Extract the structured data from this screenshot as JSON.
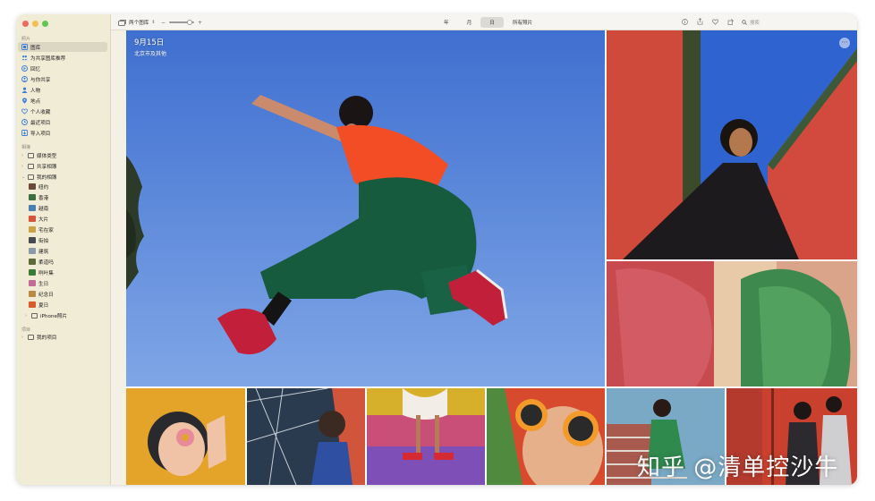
{
  "toolbar": {
    "library_selector": "两个图库",
    "view_tabs": [
      {
        "label": "年",
        "active": false
      },
      {
        "label": "月",
        "active": false
      },
      {
        "label": "日",
        "active": true
      },
      {
        "label": "所有照片",
        "active": false
      }
    ],
    "search_placeholder": "搜索"
  },
  "sidebar": {
    "section_photos": "照片",
    "items": [
      {
        "label": "图库",
        "icon": "library-icon",
        "selected": true
      },
      {
        "label": "为共享图库推荐",
        "icon": "people-shared-icon",
        "selected": false
      },
      {
        "label": "回忆",
        "icon": "memories-icon",
        "selected": false
      },
      {
        "label": "与你共享",
        "icon": "shared-with-you-icon",
        "selected": false
      },
      {
        "label": "人物",
        "icon": "people-icon",
        "selected": false
      },
      {
        "label": "地点",
        "icon": "places-icon",
        "selected": false
      },
      {
        "label": "个人收藏",
        "icon": "heart-icon",
        "selected": false
      },
      {
        "label": "最近项目",
        "icon": "clock-icon",
        "selected": false
      },
      {
        "label": "导入项目",
        "icon": "import-icon",
        "selected": false
      }
    ],
    "section_albums": "相簿",
    "album_groups": [
      {
        "label": "媒体类型"
      },
      {
        "label": "共享相簿"
      },
      {
        "label": "我的相簿"
      }
    ],
    "albums": [
      {
        "label": "纽约",
        "color": "#6a4a3a"
      },
      {
        "label": "香港",
        "color": "#3c6e46"
      },
      {
        "label": "越南",
        "color": "#4b7fb4"
      },
      {
        "label": "大片",
        "color": "#d4553a"
      },
      {
        "label": "宅在家",
        "color": "#c9a24a"
      },
      {
        "label": "街拍",
        "color": "#444a50"
      },
      {
        "label": "建筑",
        "color": "#8a9aa8"
      },
      {
        "label": "柔道吗",
        "color": "#5d6a3a"
      },
      {
        "label": "咧叶集",
        "color": "#3c7a3a"
      },
      {
        "label": "生日",
        "color": "#c26a9a"
      },
      {
        "label": "纪念日",
        "color": "#b88a4a"
      },
      {
        "label": "夏日",
        "color": "#d95a2a"
      }
    ],
    "iphone_folder": "iPhone照片",
    "section_projects": "项目",
    "projects_label": "我的项目"
  },
  "photo": {
    "date": "9月15日",
    "location": "北京市及其他"
  },
  "watermark": "知乎 @清单控沙牛"
}
